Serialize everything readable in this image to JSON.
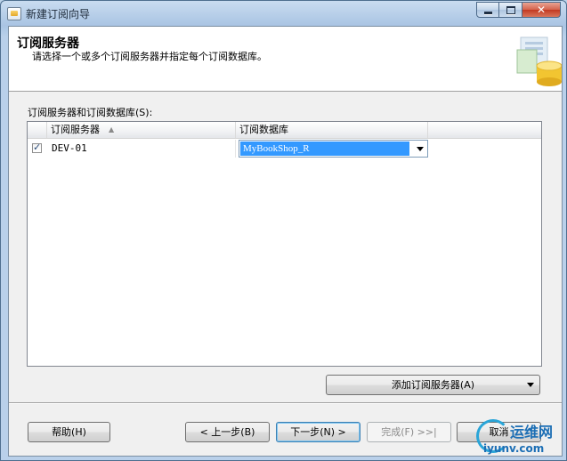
{
  "window": {
    "title": "新建订阅向导",
    "caption": {
      "minimize": "",
      "maximize": "",
      "close": "✕"
    }
  },
  "header": {
    "title": "订阅服务器",
    "subtitle": "请选择一个或多个订阅服务器并指定每个订阅数据库。"
  },
  "grid": {
    "label": "订阅服务器和订阅数据库(S):",
    "columns": [
      {
        "label": "订阅服务器",
        "sort": "ascending"
      },
      {
        "label": "订阅数据库"
      }
    ],
    "rows": [
      {
        "checked": true,
        "server": "DEV-01",
        "database": "MyBookShop_R"
      }
    ]
  },
  "buttons": {
    "add_subscriber": "添加订阅服务器(A)",
    "help": "帮助(H)",
    "back": "< 上一步(B)",
    "next": "下一步(N) >",
    "finish": "完成(F) >>|",
    "cancel": "取消"
  },
  "watermark": {
    "line1": "运维网",
    "line2": "iyunv.com"
  },
  "colors": {
    "selection": "#3399ff",
    "focus_border": "#3c7fb1"
  }
}
